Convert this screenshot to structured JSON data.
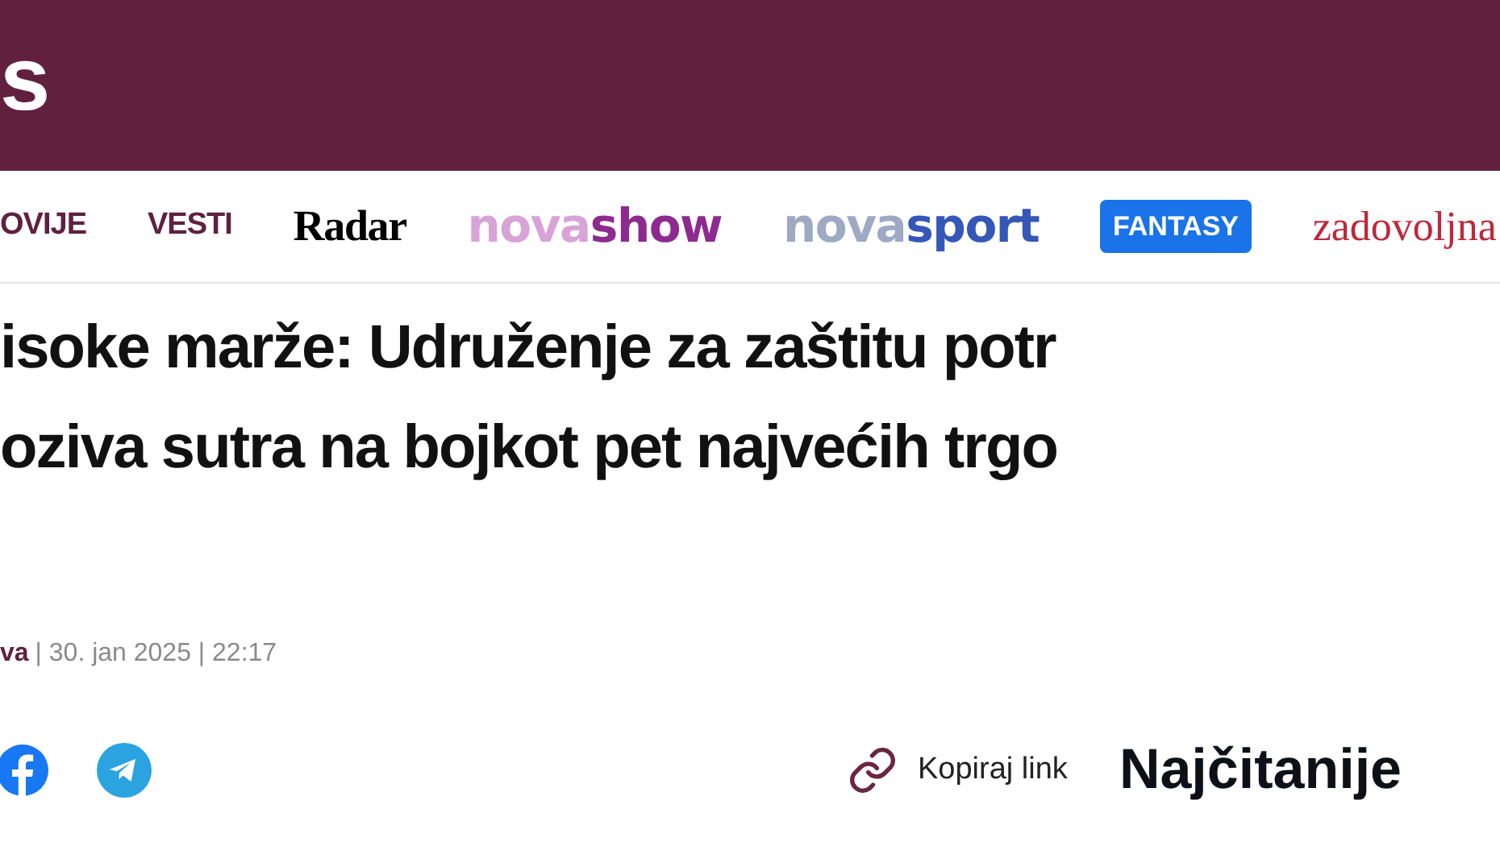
{
  "header": {
    "logo": "s"
  },
  "nav": [
    {
      "kind": "text",
      "label": "OVIJE"
    },
    {
      "kind": "text",
      "label": "VESTI"
    },
    {
      "kind": "serif",
      "label": "Radar"
    },
    {
      "kind": "split",
      "parts": [
        {
          "text": "nova",
          "color": "#d8a3d6"
        },
        {
          "text": "show",
          "color": "#8e2a8f"
        }
      ]
    },
    {
      "kind": "split",
      "parts": [
        {
          "text": "nova",
          "color": "#9ea9c3"
        },
        {
          "text": "sport",
          "color": "#3457b8"
        }
      ]
    },
    {
      "kind": "pill",
      "label": "FANTASY"
    },
    {
      "kind": "script",
      "label": "zadovoljna"
    }
  ],
  "article": {
    "headline": [
      "isoke marže: Udruženje za zaštitu potr",
      "oziva sutra na bojkot pet najvećih trgo"
    ],
    "author": "va",
    "date": "| 30. jan 2025 | 22:17",
    "copy_link": "Kopiraj link"
  },
  "sidebar": {
    "title": "Najčitanije"
  }
}
